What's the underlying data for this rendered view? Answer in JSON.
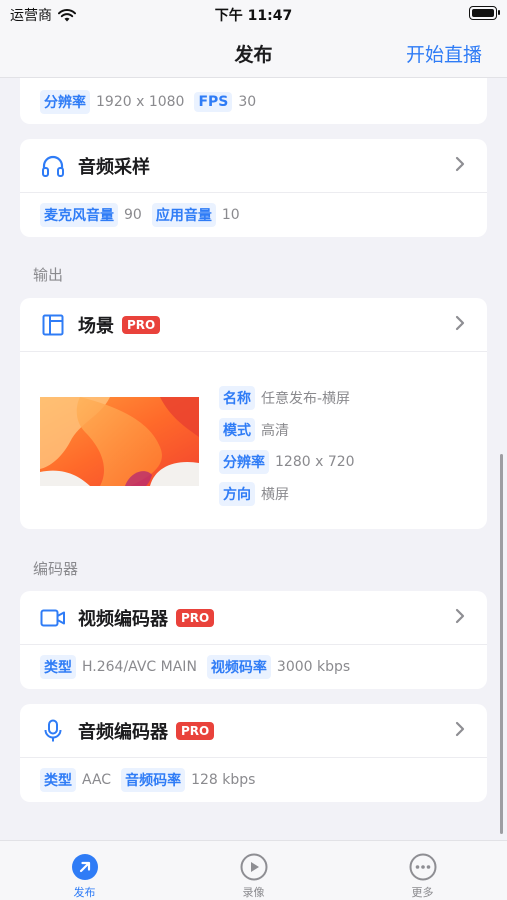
{
  "status_bar": {
    "carrier": "运营商",
    "time": "下午 11:47"
  },
  "nav": {
    "title": "发布",
    "action": "开始直播"
  },
  "video_card_partial": {
    "tags": [
      {
        "label": "分辨率",
        "value": "1920 x 1080"
      },
      {
        "label": "FPS",
        "value": "30"
      }
    ]
  },
  "audio_sampling": {
    "title": "音频采样",
    "icon": "headphones-icon",
    "tags": [
      {
        "label": "麦克风音量",
        "value": "90"
      },
      {
        "label": "应用音量",
        "value": "10"
      }
    ]
  },
  "output_section": {
    "label": "输出"
  },
  "scene": {
    "title": "场景",
    "badge": "PRO",
    "icon": "layout-icon",
    "info": [
      {
        "label": "名称",
        "value": "任意发布-横屏"
      },
      {
        "label": "模式",
        "value": "高清"
      },
      {
        "label": "分辨率",
        "value": "1280 x 720"
      },
      {
        "label": "方向",
        "value": "横屏"
      }
    ]
  },
  "encoder_section": {
    "label": "编码器"
  },
  "video_encoder": {
    "title": "视频编码器",
    "badge": "PRO",
    "icon": "video-camera-icon",
    "tags": [
      {
        "label": "类型",
        "value": "H.264/AVC MAIN"
      },
      {
        "label": "视频码率",
        "value": "3000 kbps"
      }
    ]
  },
  "audio_encoder": {
    "title": "音频编码器",
    "badge": "PRO",
    "icon": "microphone-icon",
    "tags": [
      {
        "label": "类型",
        "value": "AAC"
      },
      {
        "label": "音频码率",
        "value": "128 kbps"
      }
    ]
  },
  "tab_bar": {
    "tabs": [
      {
        "label": "发布",
        "icon": "publish-arrow-icon",
        "active": true
      },
      {
        "label": "录像",
        "icon": "play-circle-icon",
        "active": false
      },
      {
        "label": "更多",
        "icon": "more-dots-icon",
        "active": false
      }
    ]
  },
  "colors": {
    "accent": "#2f7cf6",
    "pro_badge": "#e9423b",
    "background": "#f2f2f7"
  }
}
